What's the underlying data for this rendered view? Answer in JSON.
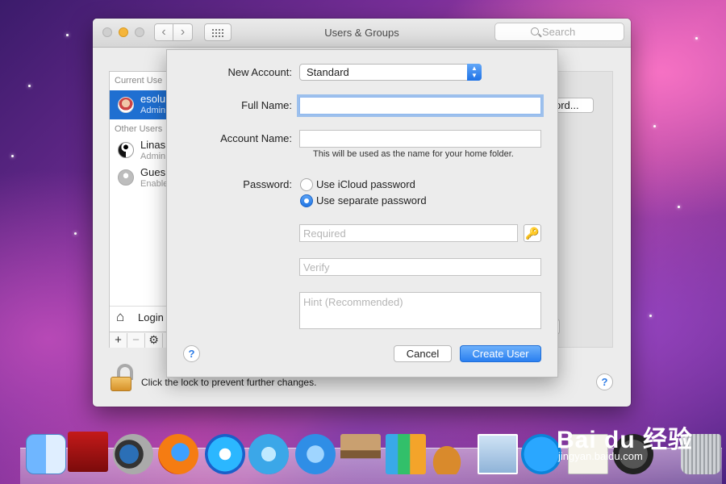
{
  "window": {
    "title": "Users & Groups",
    "search_placeholder": "Search"
  },
  "sidebar": {
    "current_users_label": "Current Use",
    "current_user": {
      "name": "esolu",
      "role": "Admin"
    },
    "other_users_label": "Other Users",
    "other_users": [
      {
        "name": "Linas",
        "role": "Admin"
      },
      {
        "name": "Gues",
        "role": "Enable"
      }
    ],
    "login_label": "Login",
    "tools": [
      "+",
      "−",
      "⚙"
    ]
  },
  "right_pane": {
    "password_button_fragment": "ord..."
  },
  "lock": {
    "text": "Click the lock to prevent further changes."
  },
  "sheet": {
    "new_account_label": "New Account:",
    "new_account_value": "Standard",
    "full_name_label": "Full Name:",
    "full_name_value": "",
    "account_name_label": "Account Name:",
    "account_name_value": "",
    "account_name_hint": "This will be used as the name for your home folder.",
    "password_label": "Password:",
    "password_options": [
      {
        "label": "Use iCloud password",
        "selected": false
      },
      {
        "label": "Use separate password",
        "selected": true
      }
    ],
    "password_placeholder": "Required",
    "verify_placeholder": "Verify",
    "hint_placeholder": "Hint (Recommended)",
    "cancel_label": "Cancel",
    "create_label": "Create User",
    "help_label": "?"
  },
  "help_label": "?",
  "dock": {
    "icons": [
      "finder-icon",
      "photo-booth-icon",
      "facetime-icon",
      "firefox-icon",
      "itunes-icon",
      "safari-icon",
      "app-store-icon",
      "keynote-icon",
      "numbers-icon",
      "garageband-icon",
      "mail-icon",
      "skype-icon",
      "textedit-icon",
      "time-machine-icon",
      "trash-icon"
    ]
  },
  "watermark": {
    "brand": "Bai du 经验",
    "url": "jingyan.baidu.com"
  },
  "colors": {
    "accent": "#2a7ff0",
    "selection": "#1f6fd1",
    "minimize": "#f5b53a"
  }
}
